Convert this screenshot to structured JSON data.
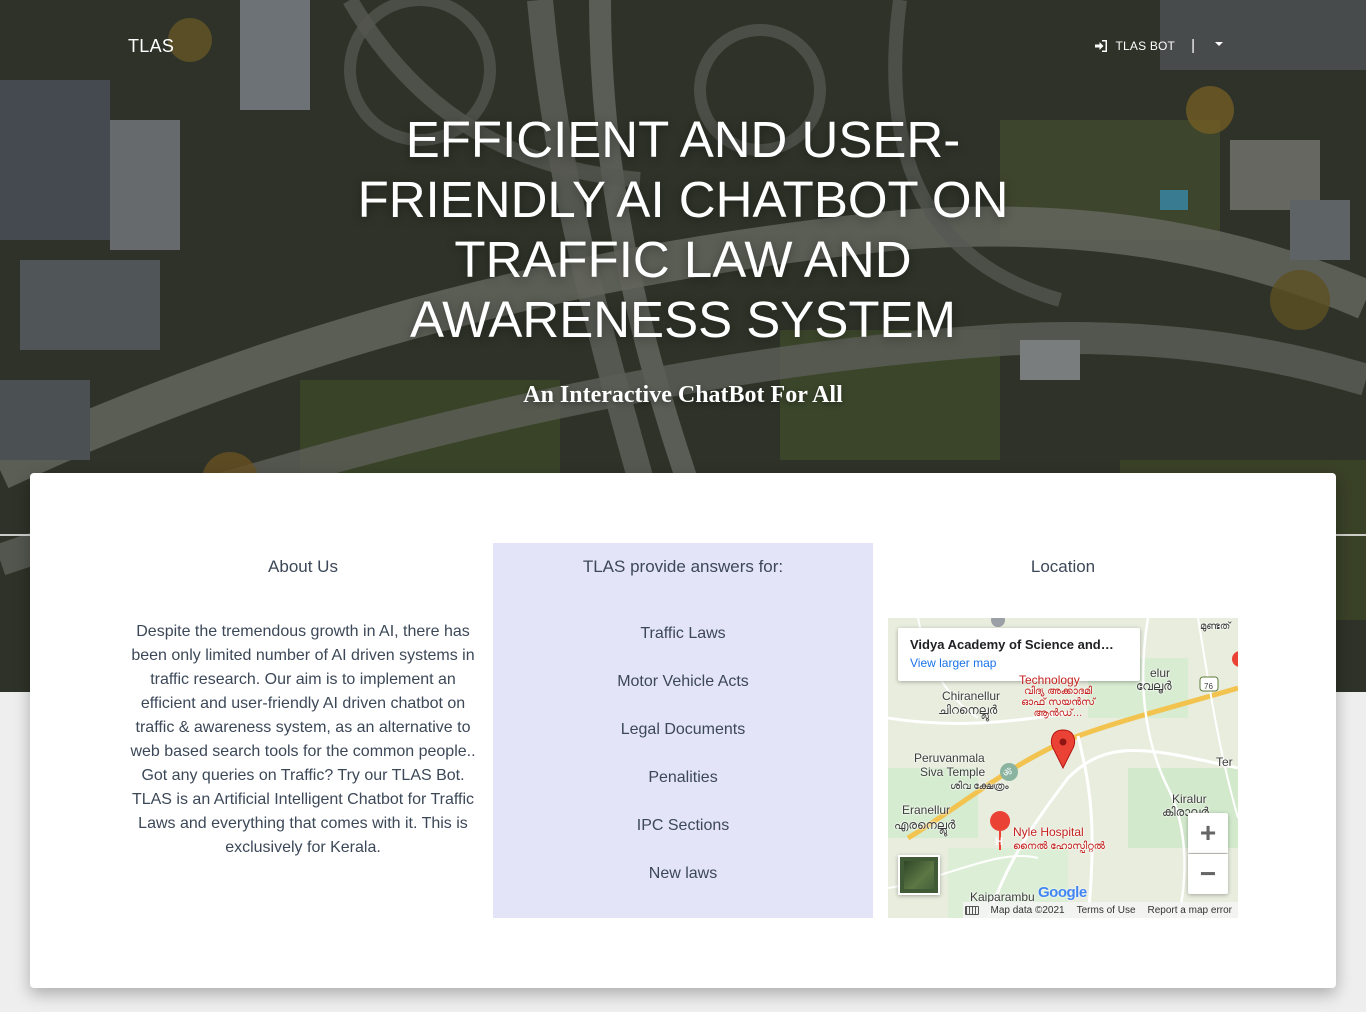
{
  "nav": {
    "brand": "TLAS",
    "bot_link": "TLAS BOT",
    "separator": "|"
  },
  "hero": {
    "title": "Efficient and User-Friendly AI Chatbot on Traffic Law and Awareness System",
    "subtitle": "An Interactive ChatBot For All"
  },
  "about": {
    "heading": "About Us",
    "text": "Despite the tremendous growth in AI, there has been only limited number of AI driven systems in traffic research. Our aim is to implement an efficient and user-friendly AI driven chatbot on traffic & awareness system, as an alternative to web based search tools for the common people.. Got any queries on Traffic? Try our TLAS Bot. TLAS is an Artificial Intelligent Chatbot for Traffic Laws and everything that comes with it. This is exclusively for Kerala."
  },
  "answers": {
    "heading": "TLAS provide answers for:",
    "items": [
      "Traffic Laws",
      "Motor Vehicle Acts",
      "Legal Documents",
      "Penalities",
      "IPC Sections",
      "New laws"
    ]
  },
  "location": {
    "heading": "Location",
    "map": {
      "place_title": "Vidya Academy of Science and…",
      "larger_map": "View larger map",
      "labels": {
        "top_right": "മുണ്ടത്",
        "technology": "Technology",
        "elur": "elur",
        "veloor_ml": "വേലൂർ",
        "route": "76",
        "chiranellur": "Chiranellur",
        "chiranellur_ml": "ചിറനെല്ലൂർ",
        "vidya_ml": "വിദ്യ അക്കാദമി ഓഫ് സയൻസ് ആൻഡ്…",
        "peruvanmala": "Peruvanmala",
        "siva_temple": "Siva Temple",
        "siva_ml": "ശിവ ക്ഷേത്രം",
        "ter": "Ter",
        "kiralur": "Kiralur",
        "kiralur_ml": "കിരാലൂർ",
        "eranellur": "Eranellur",
        "eranellur_ml": "എരനെല്ലൂർ",
        "hospital": "Nyle Hospital",
        "hospital_ml": "നൈൽ ഹോസ്പിറ്റൽ",
        "kaiparambu": "Kaiparambu",
        "google": "Google"
      },
      "zoom_in": "+",
      "zoom_out": "−",
      "footer": {
        "data": "Map data ©2021",
        "terms": "Terms of Use",
        "report": "Report a map error"
      }
    }
  },
  "colors": {
    "answers_bg": "#e4e4f8",
    "text": "#3c4858",
    "link_blue": "#1a73e8",
    "marker_red": "#ea4335"
  }
}
